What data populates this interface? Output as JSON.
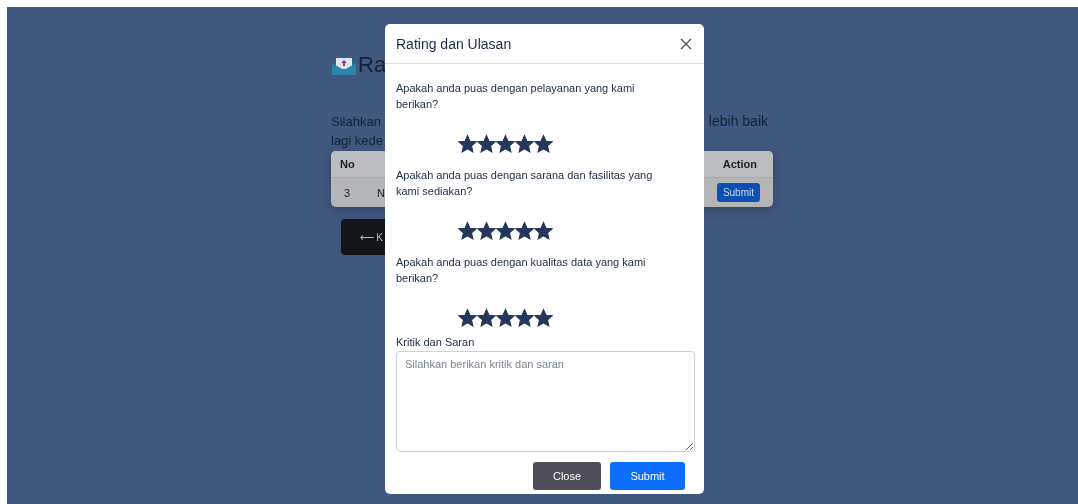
{
  "background_page": {
    "title_fragment": "Ra",
    "intro_fragments": [
      "Silahkan",
      "lebih baik",
      "lagi kede"
    ],
    "table": {
      "columns": [
        "No",
        "Action"
      ],
      "rows": [
        {
          "no": "3",
          "name_fragment": "N",
          "action": "Submit"
        }
      ]
    },
    "back_button": "⟵ K"
  },
  "modal": {
    "title": "Rating dan Ulasan",
    "questions": [
      {
        "text": "Apakah anda puas dengan pelayanan yang kami berikan?",
        "stars": 5
      },
      {
        "text": "Apakah anda puas dengan sarana dan fasilitas yang kami sediakan?",
        "stars": 5
      },
      {
        "text": "Apakah anda puas dengan kualitas data yang kami berikan?",
        "stars": 5
      }
    ],
    "feedback": {
      "label": "Kritik dan Saran",
      "placeholder": "Silahkan berikan kritik dan saran"
    },
    "buttons": [
      {
        "label": "Close",
        "kind": "secondary"
      },
      {
        "label": "Submit",
        "kind": "primary"
      }
    ]
  }
}
